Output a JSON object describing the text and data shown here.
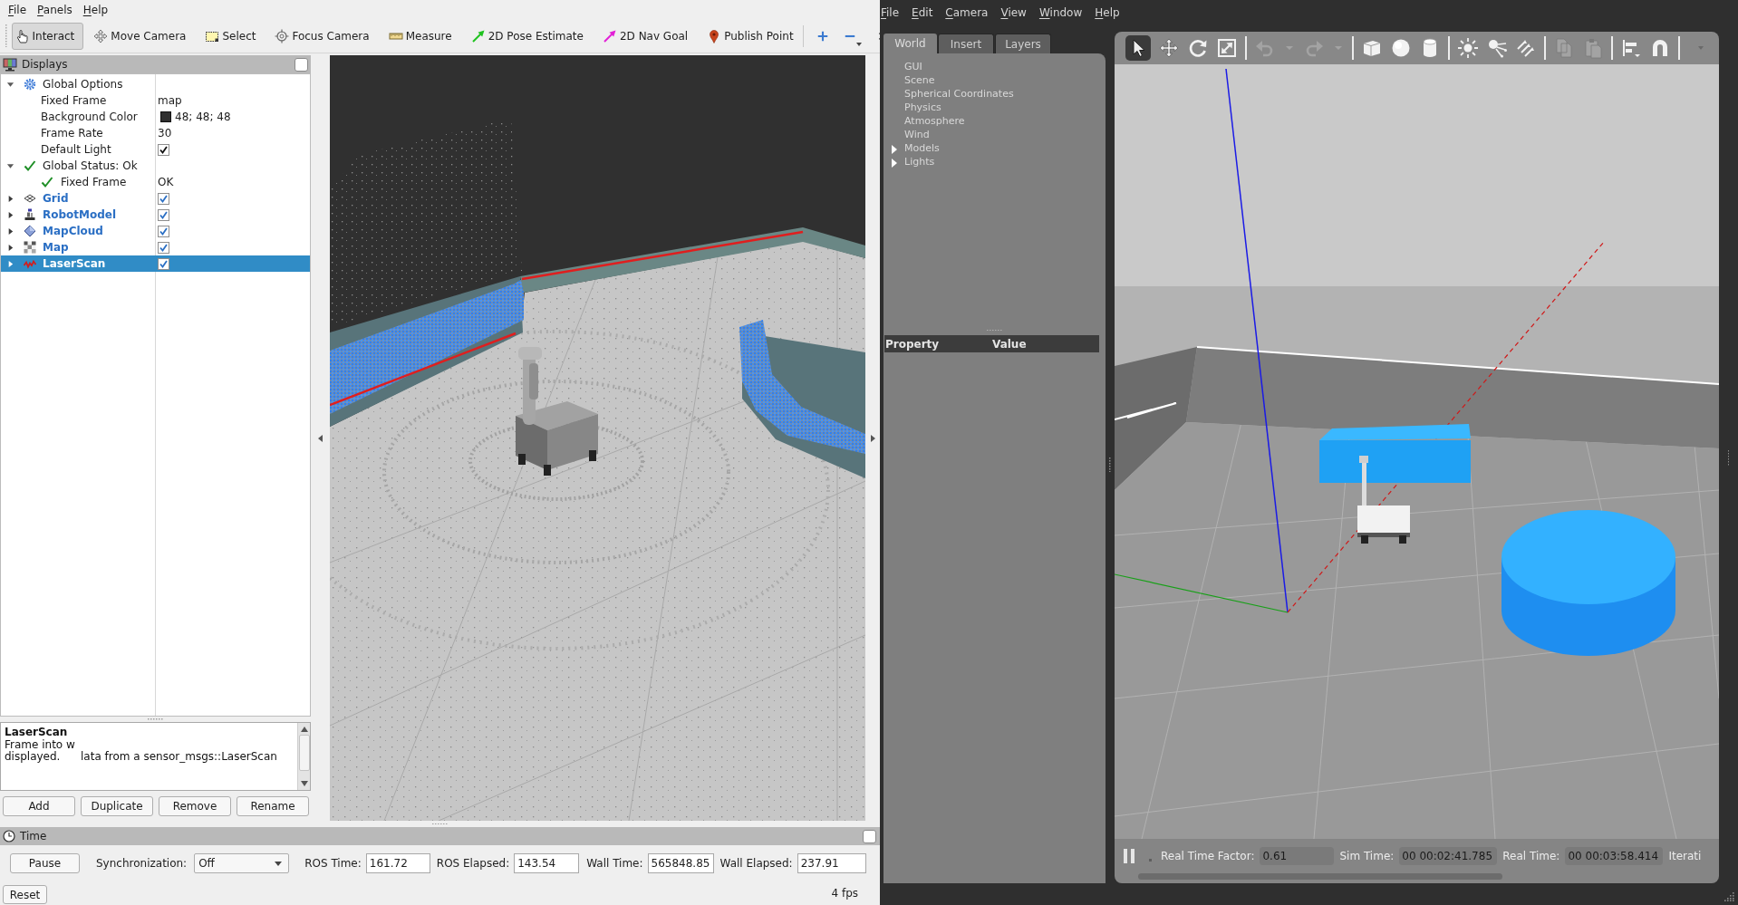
{
  "rviz": {
    "menu": [
      {
        "label": "File"
      },
      {
        "label": "Panels"
      },
      {
        "label": "Help"
      }
    ],
    "toolbar": [
      {
        "label": "Interact",
        "selected": true
      },
      {
        "label": "Move Camera",
        "selected": false
      },
      {
        "label": "Select",
        "selected": false
      },
      {
        "label": "Focus Camera",
        "selected": false
      },
      {
        "label": "Measure",
        "selected": false
      },
      {
        "label": "2D Pose Estimate",
        "selected": false
      },
      {
        "label": "2D Nav Goal",
        "selected": false
      },
      {
        "label": "Publish Point",
        "selected": false
      }
    ],
    "displays": {
      "title": "Displays",
      "items": [
        {
          "label": "Global Options",
          "kind": "group",
          "expanded": true,
          "selected": false,
          "children": [
            {
              "label": "Fixed Frame",
              "kind": "text",
              "value": "map",
              "selected": false
            },
            {
              "label": "Background Color",
              "kind": "color",
              "value": "48; 48; 48",
              "color": "#303030",
              "selected": false
            },
            {
              "label": "Frame Rate",
              "kind": "text",
              "value": "30",
              "selected": false
            },
            {
              "label": "Default Light",
              "kind": "checkbox",
              "checked": true,
              "selected": false
            }
          ]
        },
        {
          "label": "Global Status: Ok",
          "kind": "group",
          "ok": true,
          "expanded": true,
          "selected": false,
          "children": [
            {
              "label": "Fixed Frame",
              "kind": "text",
              "ok": true,
              "value": "OK",
              "selected": false
            }
          ]
        },
        {
          "label": "Grid",
          "kind": "display",
          "expanded": false,
          "checked": true,
          "selected": false
        },
        {
          "label": "RobotModel",
          "kind": "display",
          "expanded": false,
          "checked": true,
          "selected": false
        },
        {
          "label": "MapCloud",
          "kind": "display",
          "expanded": false,
          "checked": true,
          "selected": false
        },
        {
          "label": "Map",
          "kind": "display",
          "expanded": false,
          "checked": true,
          "selected": false
        },
        {
          "label": "LaserScan",
          "kind": "display",
          "expanded": false,
          "checked": true,
          "selected": true
        }
      ]
    },
    "description": {
      "title": "LaserScan",
      "lines": [
        [
          "Frame into w"
        ],
        [
          "displayed.",
          "lata from a sensor_msgs::LaserScan"
        ]
      ]
    },
    "buttons": [
      {
        "label": "Add"
      },
      {
        "label": "Duplicate"
      },
      {
        "label": "Remove"
      },
      {
        "label": "Rename"
      }
    ],
    "time": {
      "title": "Time",
      "pause": "Pause",
      "sync_label": "Synchronization:",
      "sync_value": "Off",
      "fields": [
        {
          "label": "ROS Time:",
          "value": "161.72"
        },
        {
          "label": "ROS Elapsed:",
          "value": "143.54"
        },
        {
          "label": "Wall Time:",
          "value": "565848.85"
        },
        {
          "label": "Wall Elapsed:",
          "value": "237.91"
        }
      ],
      "reset": "Reset",
      "fps": "4 fps"
    }
  },
  "gazebo": {
    "menu": [
      {
        "label": "File"
      },
      {
        "label": "Edit"
      },
      {
        "label": "Camera"
      },
      {
        "label": "View"
      },
      {
        "label": "Window"
      },
      {
        "label": "Help"
      }
    ],
    "tabs": [
      {
        "label": "World",
        "selected": true
      },
      {
        "label": "Insert",
        "selected": false
      },
      {
        "label": "Layers",
        "selected": false
      }
    ],
    "world": [
      {
        "label": "GUI"
      },
      {
        "label": "Scene"
      },
      {
        "label": "Spherical Coordinates"
      },
      {
        "label": "Physics"
      },
      {
        "label": "Atmosphere"
      },
      {
        "label": "Wind"
      },
      {
        "label": "Models",
        "expanded": false
      },
      {
        "label": "Lights",
        "expanded": false
      }
    ],
    "property_columns": [
      "Property",
      "Value"
    ],
    "tools": [
      {
        "selected": true,
        "disabled": false
      },
      {
        "selected": false,
        "disabled": false
      },
      {
        "selected": false,
        "disabled": false
      },
      {
        "selected": false,
        "disabled": false
      },
      {
        "selected": false,
        "disabled": true
      },
      {
        "selected": false,
        "disabled": true
      },
      {
        "selected": false,
        "disabled": true
      },
      {
        "selected": false,
        "disabled": true
      },
      {
        "selected": false,
        "disabled": false
      },
      {
        "selected": false,
        "disabled": false
      },
      {
        "selected": false,
        "disabled": false
      },
      {
        "selected": false,
        "disabled": false
      },
      {
        "selected": false,
        "disabled": false
      },
      {
        "selected": false,
        "disabled": false
      },
      {
        "selected": false,
        "disabled": true
      },
      {
        "selected": false,
        "disabled": true
      },
      {
        "selected": false,
        "disabled": false
      },
      {
        "selected": false,
        "disabled": false
      }
    ],
    "status": {
      "fields": [
        {
          "label": "Real Time Factor:",
          "value": "0.61"
        },
        {
          "label": "Sim Time:",
          "value": "00 00:02:41.785"
        },
        {
          "label": "Real Time:",
          "value": "00 00:03:58.414"
        }
      ],
      "cut_label": "Iterati"
    }
  }
}
